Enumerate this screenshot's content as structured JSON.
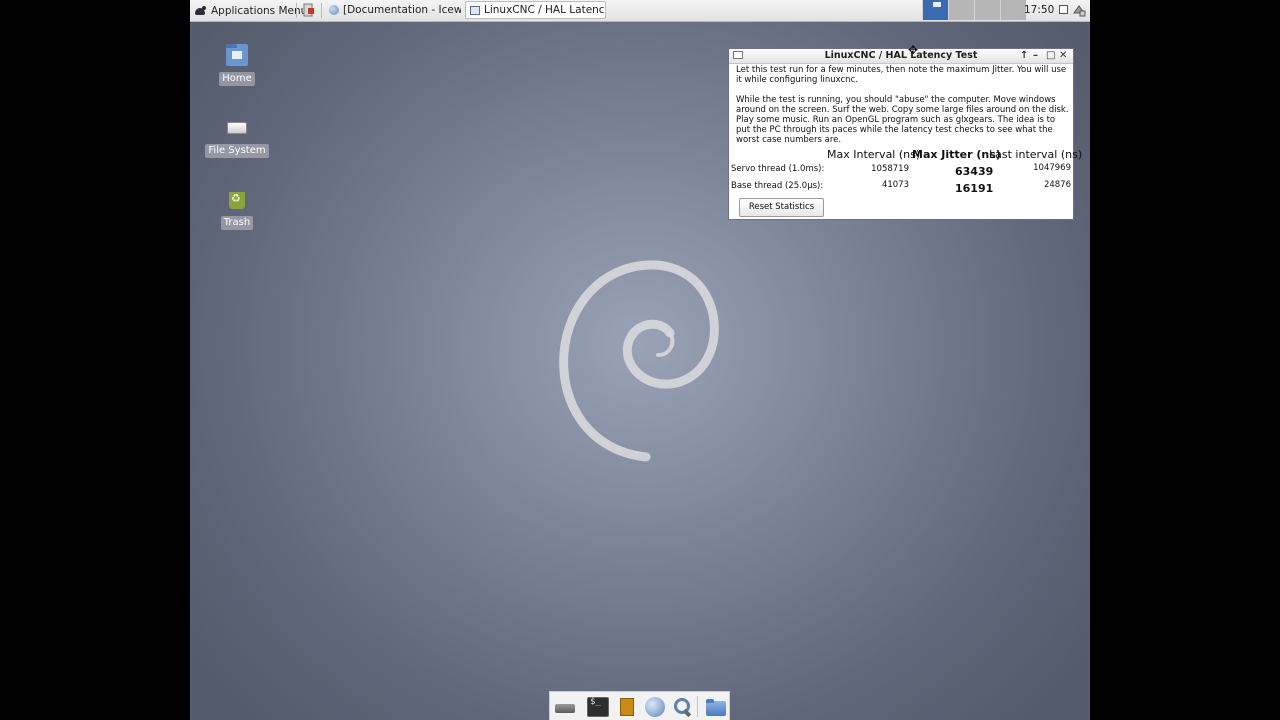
{
  "top_panel": {
    "app_menu_label": "Applications Menu",
    "tasks": [
      {
        "label": "[Documentation - Icewe...",
        "icon": "globe-icon"
      },
      {
        "label": "LinuxCNC / HAL Latency...",
        "icon": "window-icon"
      }
    ],
    "workspaces_count": 4,
    "active_workspace": 1,
    "clock": "17:50"
  },
  "desktop": {
    "icons": [
      {
        "label": "Home",
        "icon": "home-folder-icon"
      },
      {
        "label": "File System",
        "icon": "drive-icon"
      },
      {
        "label": "Trash",
        "icon": "trash-icon"
      }
    ]
  },
  "latency_window": {
    "title": "LinuxCNC / HAL Latency Test",
    "paragraph1": "Let this test run for a few minutes, then note the maximum Jitter.  You will use it while configuring linuxcnc.",
    "paragraph2": "While the test is running, you should \"abuse\" the computer. Move windows around on the screen. Surf the web. Copy some large files around on the disk. Play some music. Run an OpenGL program such as glxgears. The idea is to put the PC through its paces while the latency test checks to see what the worst case numbers are.",
    "headers": {
      "max_interval": "Max Interval (ns)",
      "max_jitter": "Max Jitter (ns)",
      "last_interval": "Last interval (ns)"
    },
    "rows": [
      {
        "label": "Servo thread (1.0ms):",
        "max_interval": "1058719",
        "max_jitter": "63439",
        "last_interval": "1047969"
      },
      {
        "label": "Base thread (25.0µs):",
        "max_interval": "41073",
        "max_jitter": "16191",
        "last_interval": "24876"
      }
    ],
    "reset_button": "Reset Statistics"
  },
  "dock": {
    "items": [
      "drive-icon",
      "terminal-icon",
      "text-editor-icon",
      "web-browser-icon",
      "search-icon",
      "file-manager-icon"
    ],
    "terminal_glyph": "$_"
  },
  "colors": {
    "desktop_center": "#9aa2b7",
    "desktop_edge": "#545b6d",
    "active_workspace": "#3c6ab2"
  }
}
